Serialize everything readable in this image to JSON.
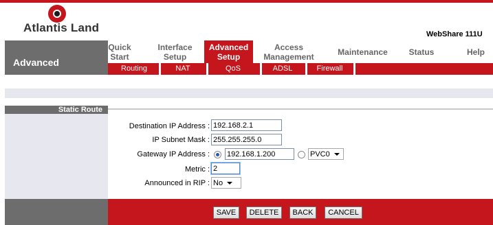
{
  "brand": {
    "logo_text": "Atlantis Land",
    "product": "WebShare 111U"
  },
  "section": "Advanced",
  "nav": {
    "items": [
      {
        "line1": "Quick",
        "line2": "Start"
      },
      {
        "line1": "Interface",
        "line2": "Setup"
      },
      {
        "line1": "Advanced",
        "line2": "Setup"
      },
      {
        "line1": "Access",
        "line2": "Management"
      },
      {
        "line1": "Maintenance",
        "line2": ""
      },
      {
        "line1": "Status",
        "line2": ""
      },
      {
        "line1": "Help",
        "line2": ""
      }
    ],
    "active": "Advanced Setup"
  },
  "subnav": {
    "items": [
      "Routing",
      "NAT",
      "QoS",
      "ADSL",
      "Firewall"
    ]
  },
  "sidebar": {
    "title": "Static Route"
  },
  "form": {
    "dest_ip": {
      "label": "Destination IP Address :",
      "value": "192.168.2.1"
    },
    "subnet_mask": {
      "label": "IP Subnet Mask :",
      "value": "255.255.255.0"
    },
    "gateway": {
      "label": "Gateway IP Address :",
      "ip_value": "192.168.1.200",
      "pvc_value": "PVC0",
      "selected": "ip"
    },
    "metric": {
      "label": "Metric :",
      "value": "2"
    },
    "rip": {
      "label": "Announced in RIP :",
      "value": "No"
    }
  },
  "buttons": {
    "save": "SAVE",
    "delete": "DELETE",
    "back": "BACK",
    "cancel": "CANCEL"
  },
  "colors": {
    "brand_red": "#c4161c",
    "panel_gray": "#6d6d6d",
    "light_bg": "#e7e7f0"
  }
}
